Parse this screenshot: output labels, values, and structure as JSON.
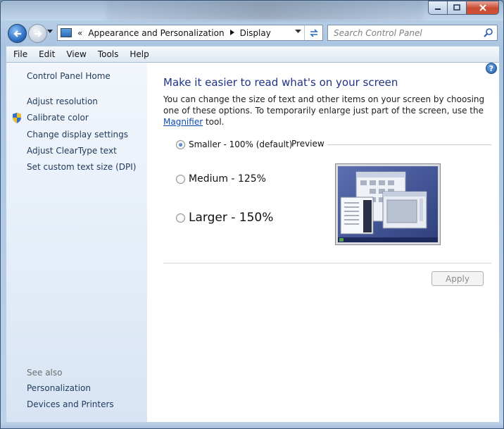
{
  "window": {
    "caption_buttons": {
      "minimize_icon": "minimize-icon",
      "maximize_icon": "maximize-icon",
      "close_icon": "close-icon"
    }
  },
  "navbar": {
    "breadcrumb_overflow": "«",
    "breadcrumb": [
      "Appearance and Personalization",
      "Display"
    ],
    "search_placeholder": "Search Control Panel"
  },
  "menu": {
    "items": [
      "File",
      "Edit",
      "View",
      "Tools",
      "Help"
    ]
  },
  "sidebar": {
    "home": "Control Panel Home",
    "tasks": [
      "Adjust resolution",
      "Calibrate color",
      "Change display settings",
      "Adjust ClearType text",
      "Set custom text size (DPI)"
    ],
    "see_also_label": "See also",
    "see_also": [
      "Personalization",
      "Devices and Printers"
    ]
  },
  "main": {
    "help_glyph": "?",
    "title": "Make it easier to read what's on your screen",
    "desc_before_link": "You can change the size of text and other items on your screen by choosing one of these options. To temporarily enlarge just part of the screen, use the ",
    "desc_link": "Magnifier",
    "desc_after_link": " tool.",
    "options": [
      {
        "label": "Smaller - 100% (default)",
        "checked": true
      },
      {
        "label": "Medium - 125%",
        "checked": false
      },
      {
        "label": "Larger - 150%",
        "checked": false
      }
    ],
    "preview_label": "Preview",
    "apply_label": "Apply"
  },
  "colors": {
    "title_blue": "#1e3287",
    "link_blue": "#1e395b",
    "sidebar_bg": "#e4edf8",
    "preview_desktop": "#4a5c9c"
  }
}
